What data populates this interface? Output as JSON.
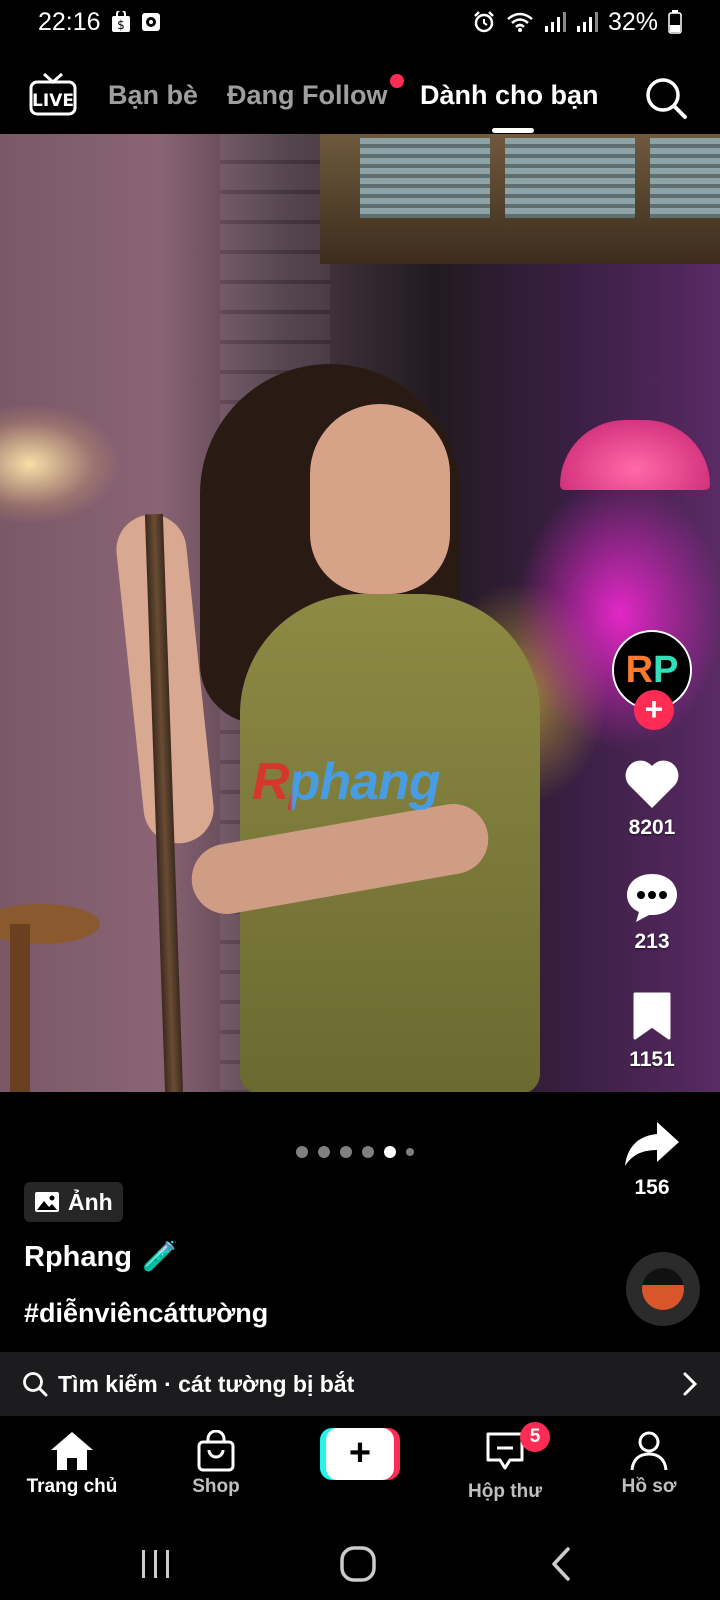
{
  "status_bar": {
    "time": "22:16",
    "battery": "32%",
    "icons": [
      "shopping-bag-icon",
      "media-notification-icon",
      "alarm-icon",
      "wifi-icon",
      "signal-icon",
      "signal-icon",
      "battery-icon"
    ]
  },
  "top_nav": {
    "live_icon": "live-tv-icon",
    "tabs": [
      {
        "label": "Bạn bè"
      },
      {
        "label": "Đang Follow"
      },
      {
        "label": "Dành cho bạn"
      }
    ],
    "active_tab": "Dành cho bạn",
    "search_icon": "search-icon"
  },
  "post": {
    "watermark": "Rphang",
    "avatar_text": "RP",
    "likes": "8201",
    "comments": "213",
    "saves": "1151",
    "shares": "156",
    "carousel_dots": 6,
    "carousel_active": 5,
    "type_badge": "Ảnh",
    "username": "Rphang",
    "username_emoji": "🧪",
    "caption": "#diễnviêncáttường"
  },
  "search_suggestion": {
    "text": "Tìm kiếm · cát tường bị bắt"
  },
  "bottom_nav": {
    "home": "Trang chủ",
    "shop": "Shop",
    "inbox": "Hộp thư",
    "inbox_badge": "5",
    "profile": "Hồ sơ"
  },
  "colors": {
    "accent_red": "#fe2c55",
    "accent_cyan": "#25f4ee",
    "background": "#000000"
  }
}
